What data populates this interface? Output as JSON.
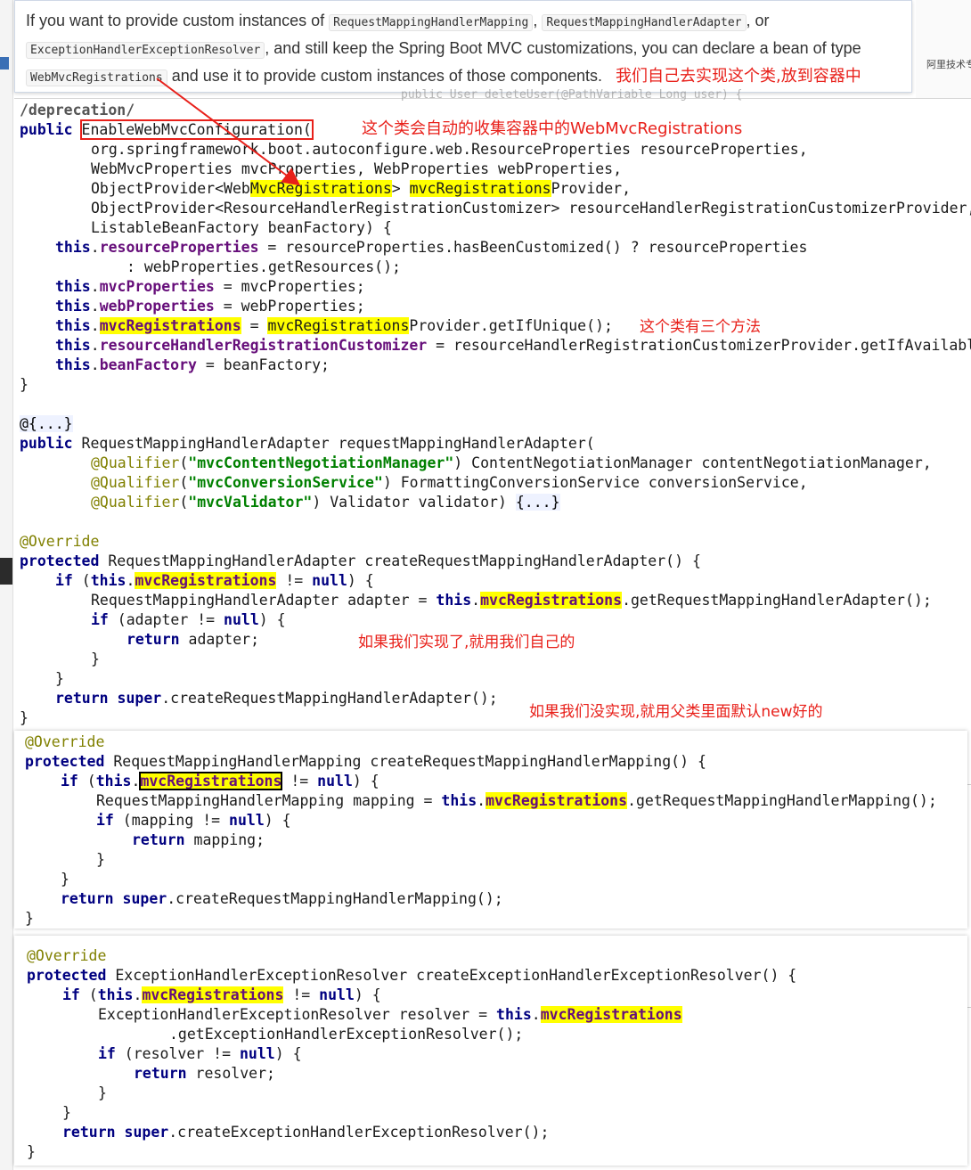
{
  "doc": {
    "t1": "If you want to provide custom instances of ",
    "c1": "RequestMappingHandlerMapping",
    "t2": ", ",
    "c2": "RequestMappingHandlerAdapter",
    "t3": ", or",
    "c3": "ExceptionHandlerExceptionResolver",
    "t4": ", and still keep the Spring Boot MVC customizations, you can declare a bean of type",
    "c4": "WebMvcRegistrations",
    "t5": " and use it to provide custom instances of those components.",
    "note": "我们自己去实现这个类,放到容器中"
  },
  "background": {
    "right_tag": "阿里技术专家",
    "ghost_line": "public User deleteUser(@PathVariable Long user) {"
  },
  "notes": {
    "n1": "这个类会自动的收集容器中的WebMvcRegistrations",
    "n2": "这个类有三个方法",
    "n3": "如果我们实现了,就用我们自己的",
    "n4": "如果我们没实现,就用父类里面默认new好的"
  },
  "code": {
    "l1": "/deprecation/",
    "kw_public": "public",
    "kw_protected": "protected",
    "kw_this": "this",
    "kw_if": "if",
    "kw_null": "null",
    "kw_return": "return",
    "kw_super": "super",
    "ctor": "EnableWebMvcConfiguration(",
    "p1": "org.springframework.boot.autoconfigure.web.ResourceProperties resourceProperties,",
    "p2": "WebMvcProperties mvcProperties, WebProperties webProperties,",
    "p3a": "ObjectProvider<Web",
    "p3b": "MvcRegistrations",
    "p3c": "> ",
    "p3d": "mvcRegistrations",
    "p3e": "Provider,",
    "p4": "ObjectProvider<ResourceHandlerRegistrationCustomizer> resourceHandlerRegistrationCustomizerProvider,",
    "p5": "ListableBeanFactory beanFactory) {",
    "a1f": "resourceProperties",
    "a1r": " = resourceProperties.hasBeenCustomized() ? resourceProperties",
    "a1c": ": webProperties.getResources();",
    "a2f": "mvcProperties",
    "a2r": " = mvcProperties;",
    "a3f": "webProperties",
    "a3r": " = webProperties;",
    "a4f": "mvcRegistrations",
    "a4m": " = ",
    "a4h": "mvcRegistrations",
    "a4r": "Provider.getIfUnique();",
    "a5f": "resourceHandlerRegistrationCustomizer",
    "a5r": " = resourceHandlerRegistrationCustomizerProvider.getIfAvailable();",
    "a6f": "beanFactory",
    "a6r": " = beanFactory;",
    "close": "}",
    "fold": "@{...}",
    "adapter_sig": " RequestMappingHandlerAdapter requestMappingHandlerAdapter(",
    "q": "@Qualifier",
    "q1s": "\"mvcContentNegotiationManager\"",
    "q1r": ") ContentNegotiationManager contentNegotiationManager,",
    "q2s": "\"mvcConversionService\"",
    "q2r": ") FormattingConversionService conversionService,",
    "q3s": "\"mvcValidator\"",
    "q3r": ") Validator validator) ",
    "fold2": "{...}",
    "override": "@Override",
    "m1sig": " RequestMappingHandlerAdapter createRequestMappingHandlerAdapter() {",
    "mvcreg": "mvcRegistrations",
    "ne_null": " != ",
    "m1l2": "RequestMappingHandlerAdapter adapter = ",
    "m1l2b": ".getRequestMappingHandlerAdapter();",
    "m1l3": " (adapter != ",
    "m1l4": " adapter;",
    "m1ret": ".createRequestMappingHandlerAdapter();",
    "m2sig": " RequestMappingHandlerMapping createRequestMappingHandlerMapping() {",
    "m2l2": "RequestMappingHandlerMapping mapping = ",
    "m2l2b": ".getRequestMappingHandlerMapping();",
    "m2l3": " (mapping != ",
    "m2l4": " mapping;",
    "m2ret": ".createRequestMappingHandlerMapping();",
    "m3sig": " ExceptionHandlerExceptionResolver createExceptionHandlerExceptionResolver() {",
    "m3l2": "ExceptionHandlerExceptionResolver resolver = ",
    "m3l2b": ".getExceptionHandlerExceptionResolver();",
    "m3l3": " (resolver != ",
    "m3l4": " resolver;",
    "m3ret": ".createExceptionHandlerExceptionResolver();"
  }
}
